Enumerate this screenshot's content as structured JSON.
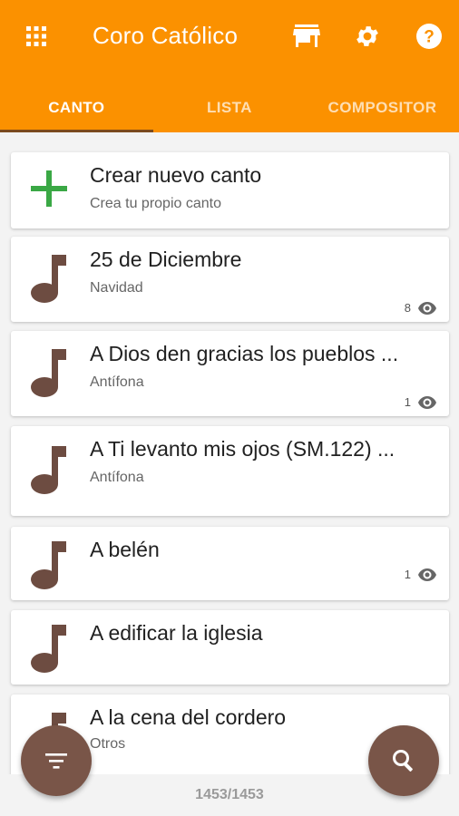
{
  "app": {
    "title": "Coro Católico"
  },
  "header": {
    "icons": [
      "apps-grid-icon",
      "store-icon",
      "settings-gear-icon",
      "help-icon"
    ]
  },
  "tabs": [
    {
      "label": "CANTO",
      "active": true
    },
    {
      "label": "LISTA",
      "active": false
    },
    {
      "label": "COMPOSITOR",
      "active": false
    }
  ],
  "create_card": {
    "title": "Crear nuevo canto",
    "subtitle": "Crea tu propio canto"
  },
  "songs": [
    {
      "title": "25 de Diciembre",
      "category": "Navidad",
      "views": "8"
    },
    {
      "title": "A Dios den gracias los pueblos ...",
      "category": "Antífona",
      "views": "1"
    },
    {
      "title": "A Ti levanto mis ojos (SM.122) ...",
      "category": "Antífona",
      "views": ""
    },
    {
      "title": "A belén",
      "category": "",
      "views": "1"
    },
    {
      "title": "A edificar la iglesia",
      "category": "",
      "views": ""
    },
    {
      "title": "A la cena del cordero",
      "category": "Otros",
      "views": ""
    }
  ],
  "footer": {
    "count": "1453/1453"
  },
  "colors": {
    "primary": "#fb9100",
    "accent": "#795548",
    "plus": "#3aa845"
  }
}
